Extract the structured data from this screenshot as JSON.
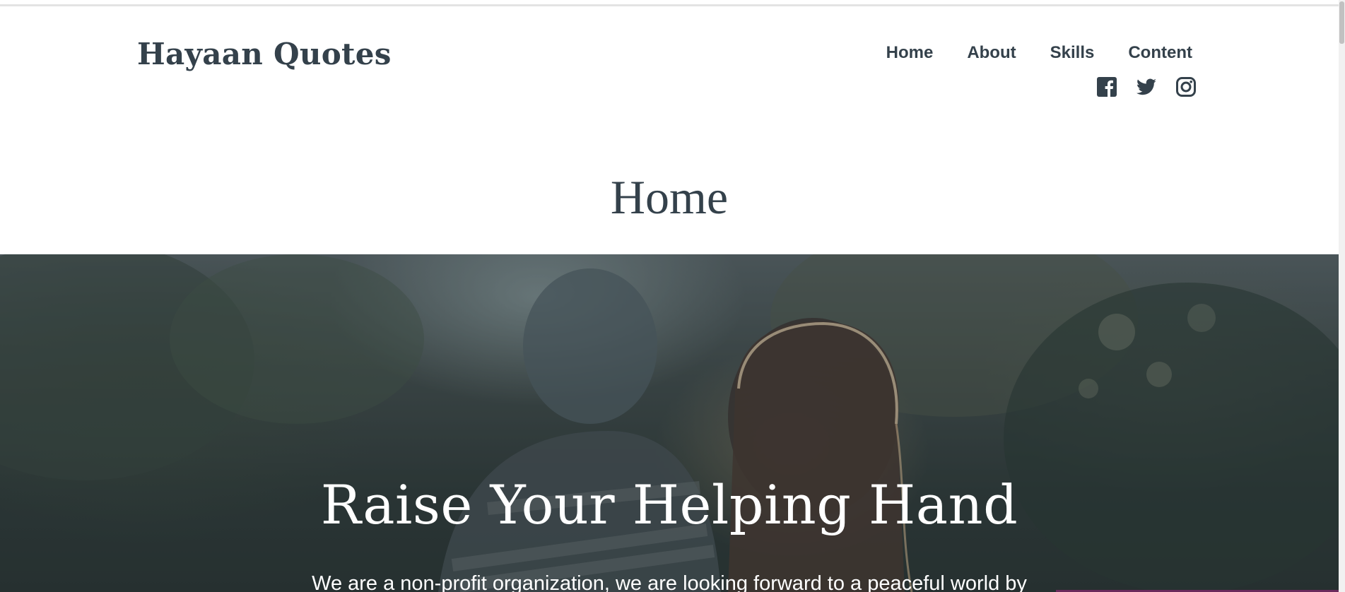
{
  "header": {
    "brand": "Hayaan Quotes",
    "nav": [
      "Home",
      "About",
      "Skills",
      "Content"
    ],
    "social_icons": [
      "facebook-icon",
      "twitter-icon",
      "instagram-icon"
    ]
  },
  "page": {
    "title": "Home"
  },
  "hero": {
    "title": "Raise Your Helping Hand",
    "text": "We are a non-profit organization, we are looking forward to a peaceful world by"
  },
  "colors": {
    "text": "#34414b",
    "hero_text": "#ffffff",
    "accent": "#6b2a5c"
  }
}
